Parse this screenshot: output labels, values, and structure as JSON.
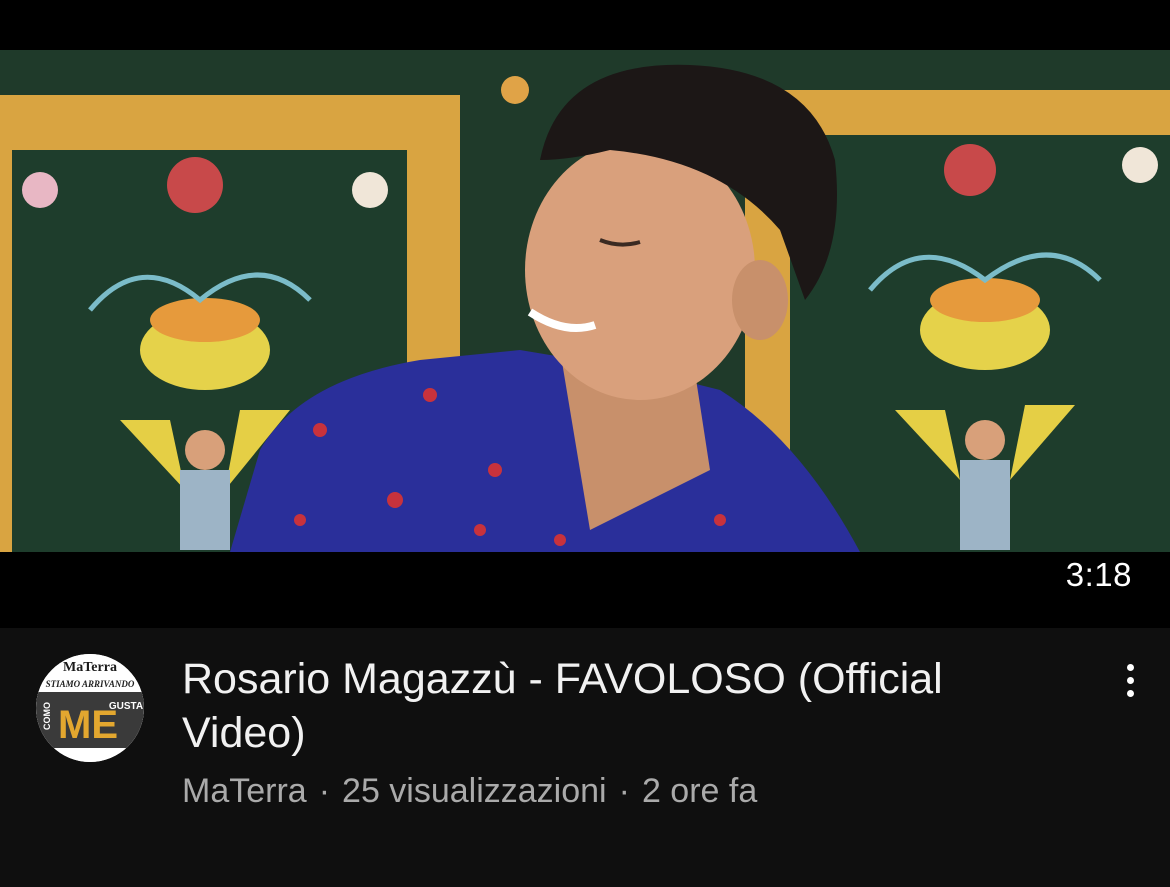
{
  "video": {
    "title": "Rosario Magazzù - FAVOLOSO (Official Video)",
    "duration": "3:18",
    "channel": "MaTerra",
    "views": "25 visualizzazioni",
    "age": "2 ore fa",
    "separator": "·"
  },
  "avatar": {
    "logo_top": "MaTerra",
    "logo_band": "STIAMO ARRIVANDO",
    "logo_big": "ME",
    "logo_left": "COMO",
    "logo_right": "GUSTA"
  },
  "menu": {
    "icon": "more-vertical-icon"
  },
  "colors": {
    "background": "#0f0f0f",
    "title_text": "#f1f1f1",
    "secondary_text": "#aaaaaa",
    "duration_text": "#ffffff"
  }
}
